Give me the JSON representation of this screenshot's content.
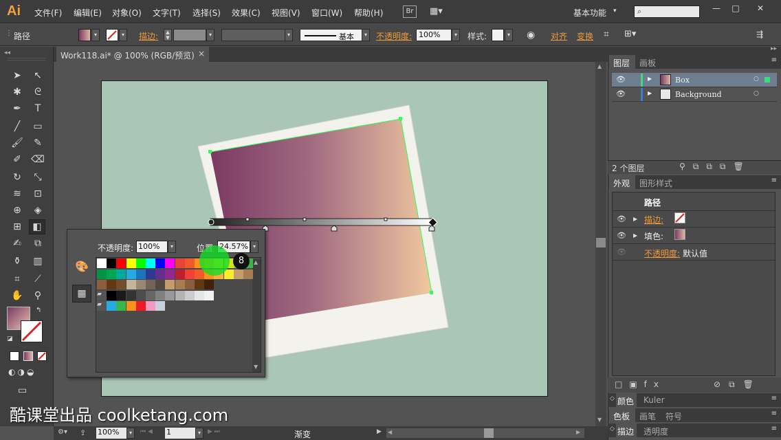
{
  "app": {
    "logo": "Ai",
    "menu": [
      "文件(F)",
      "编辑(E)",
      "对象(O)",
      "文字(T)",
      "选择(S)",
      "效果(C)",
      "视图(V)",
      "窗口(W)",
      "帮助(H)"
    ],
    "br_button": "Br",
    "workspace": "基本功能",
    "window_controls": [
      "—",
      "□",
      "✕"
    ]
  },
  "control_bar": {
    "object_type": "路径",
    "stroke_label": "描边:",
    "stroke_style_label": "基本",
    "opacity_label": "不透明度:",
    "opacity_value": "100%",
    "style_label": "样式:",
    "align_label": "对齐",
    "transform_label": "变换"
  },
  "document": {
    "tab_title": "Work118.ai* @ 100% (RGB/预览)",
    "tab_close": "×"
  },
  "statusbar": {
    "zoom": "100%",
    "artboard_nav": "1",
    "status_text": "渐变"
  },
  "layers_panel": {
    "tabs": [
      "图层",
      "画板"
    ],
    "layers": [
      {
        "name": "Box",
        "color": "#3cdc7c"
      },
      {
        "name": "Background",
        "color": "#3c7cdc"
      }
    ],
    "footer": "2 个图层"
  },
  "appearance_panel": {
    "tabs": [
      "外观",
      "图形样式"
    ],
    "title": "路径",
    "rows": [
      {
        "label": "描边:"
      },
      {
        "label": "填色:"
      },
      {
        "label": "不透明度:",
        "value": "默认值"
      }
    ]
  },
  "bottom_panels": [
    {
      "tabs": [
        "颜色",
        "Kuler"
      ]
    },
    {
      "tabs": [
        "色板",
        "画笔",
        "符号"
      ]
    },
    {
      "tabs": [
        "描边",
        "透明度"
      ]
    }
  ],
  "gradient_popup": {
    "opacity_label": "不透明度:",
    "opacity_value": "100%",
    "position_label": "位置",
    "position_value": "24.57%",
    "badge": "8"
  },
  "watermark": {
    "text": "酷课堂出品 coolketang.com"
  },
  "colors": {
    "accent_orange": "#f09838",
    "artboard_bg": "#a9c6b6",
    "gradient_start": "#7a3a62",
    "gradient_end": "#f0c8a0",
    "selection": "#2cff5c"
  }
}
